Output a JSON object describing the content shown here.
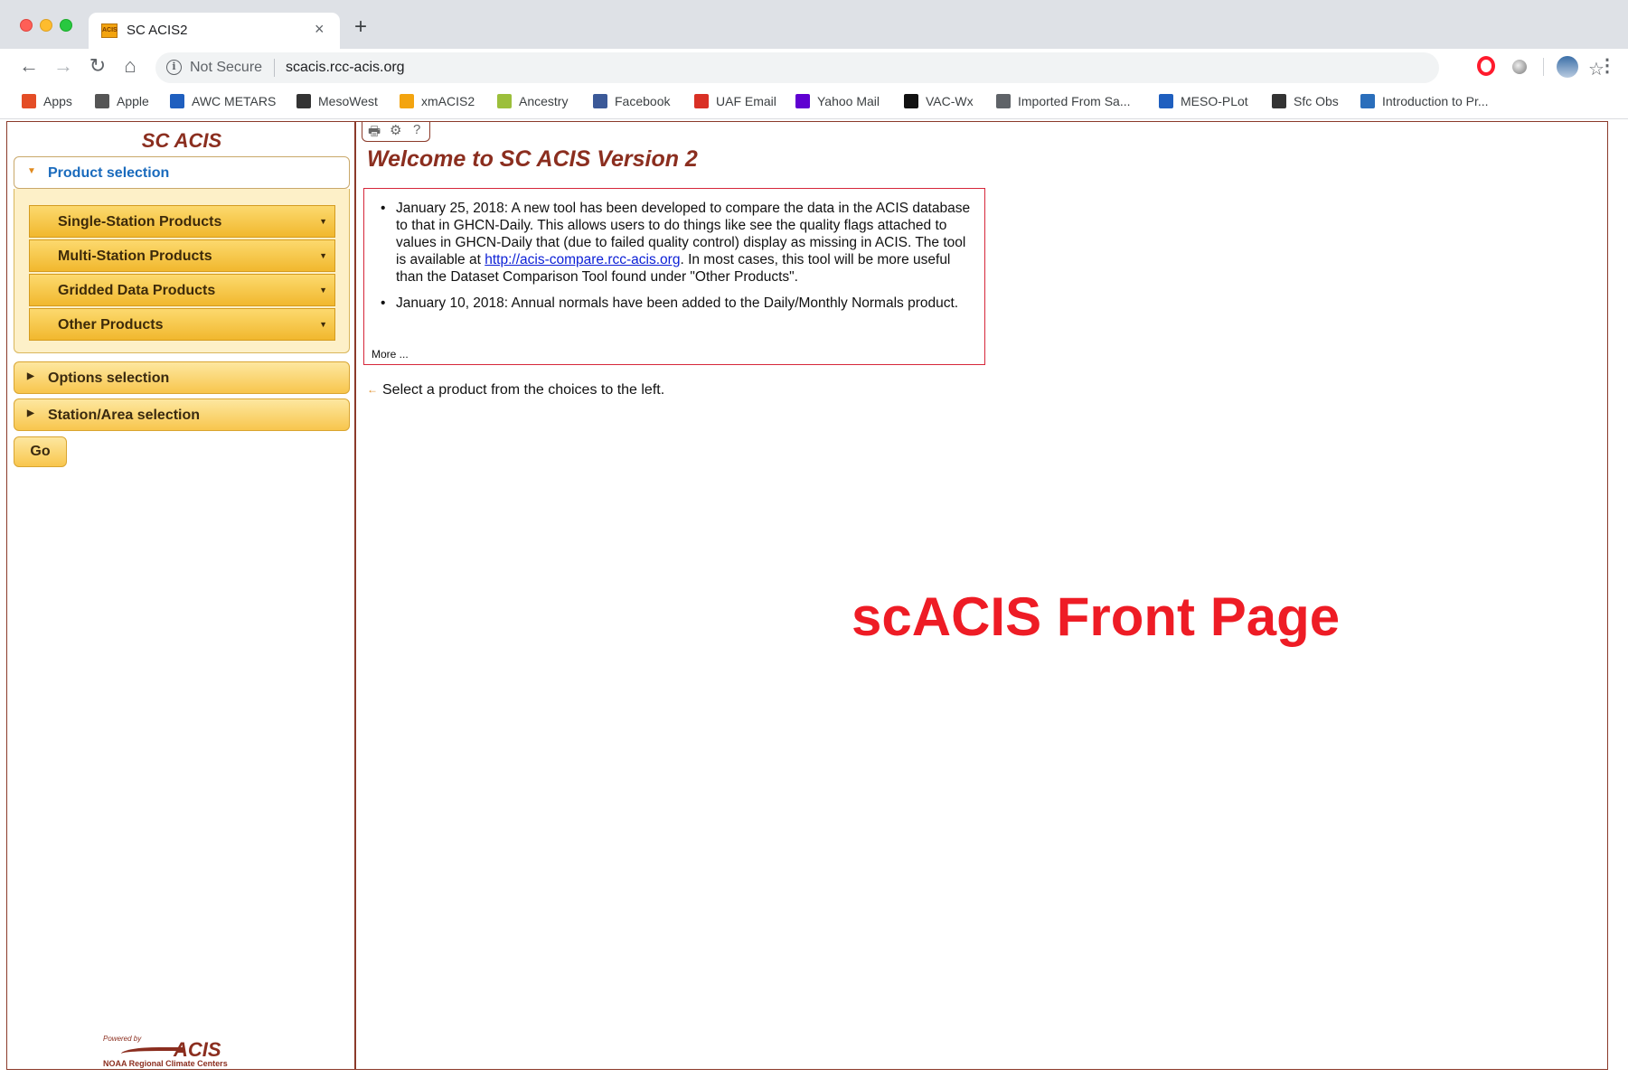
{
  "browser": {
    "tab_title": "SC ACIS2",
    "tab_favicon": "ACIS",
    "tab_close": "×",
    "new_tab": "+",
    "security": "Not Secure",
    "url": "scacis.rcc-acis.org",
    "nav": {
      "back": "←",
      "forward": "→",
      "reload": "↻",
      "home": "⌂"
    },
    "star": "☆",
    "menu": "⋮",
    "bookmarks": [
      {
        "label": "Apps",
        "icon": "apps-grid-icon",
        "color": "#e44d26"
      },
      {
        "label": "Apple",
        "icon": "apple-icon",
        "color": "#555555"
      },
      {
        "label": "AWC METARS",
        "icon": "noaa-icon",
        "color": "#1f5fbf"
      },
      {
        "label": "MesoWest",
        "icon": "globe-icon",
        "color": "#333333"
      },
      {
        "label": "xmACIS2",
        "icon": "acis-icon",
        "color": "#f3a40f"
      },
      {
        "label": "Ancestry",
        "icon": "ancestry-leaf-icon",
        "color": "#9cbf3b"
      },
      {
        "label": "Facebook",
        "icon": "facebook-icon",
        "color": "#3b5998"
      },
      {
        "label": "UAF Email",
        "icon": "gmail-icon",
        "color": "#d93025"
      },
      {
        "label": "Yahoo Mail",
        "icon": "yahoo-icon",
        "color": "#5f01d1"
      },
      {
        "label": "VAC-Wx",
        "icon": "vac-wx-icon",
        "color": "#111111"
      },
      {
        "label": "Imported From Sa...",
        "icon": "folder-icon",
        "color": "#5f6368"
      },
      {
        "label": "MESO-PLot",
        "icon": "noaa-icon",
        "color": "#1f5fbf"
      },
      {
        "label": "Sfc Obs",
        "icon": "bird-icon",
        "color": "#333333"
      },
      {
        "label": "Introduction to Pr...",
        "icon": "r-logo-icon",
        "color": "#2a6ebb"
      }
    ]
  },
  "sidebar": {
    "title": "SC ACIS",
    "product_selection": "Product selection",
    "products": [
      "Single-Station Products",
      "Multi-Station Products",
      "Gridded Data Products",
      "Other Products"
    ],
    "options_selection": "Options selection",
    "station_area_selection": "Station/Area selection",
    "go": "Go",
    "powered_by": "Powered by",
    "powered_logo": "ACIS",
    "powered_org": "NOAA Regional Climate Centers"
  },
  "content": {
    "tools": {
      "print": "🖶",
      "settings": "⚙",
      "help": "?"
    },
    "welcome": "Welcome to SC ACIS Version 2",
    "news": {
      "item1_before": "January 25, 2018: A new tool has been developed to compare the data in the ACIS database to that in GHCN-Daily. This allows users to do things like see the quality flags attached to values in GHCN-Daily that (due to failed quality control) display as missing in ACIS. The tool is available at ",
      "item1_link": "http://acis-compare.rcc-acis.org",
      "item1_after": ". In most cases, this tool will be more useful than the Dataset Comparison Tool found under \"Other Products\".",
      "item2": "January 10, 2018: Annual normals have been added to the Daily/Monthly Normals product.",
      "more": "More ..."
    },
    "hint": "Select a product from the choices to the left.",
    "overlay_title": "scACIS Front Page"
  }
}
